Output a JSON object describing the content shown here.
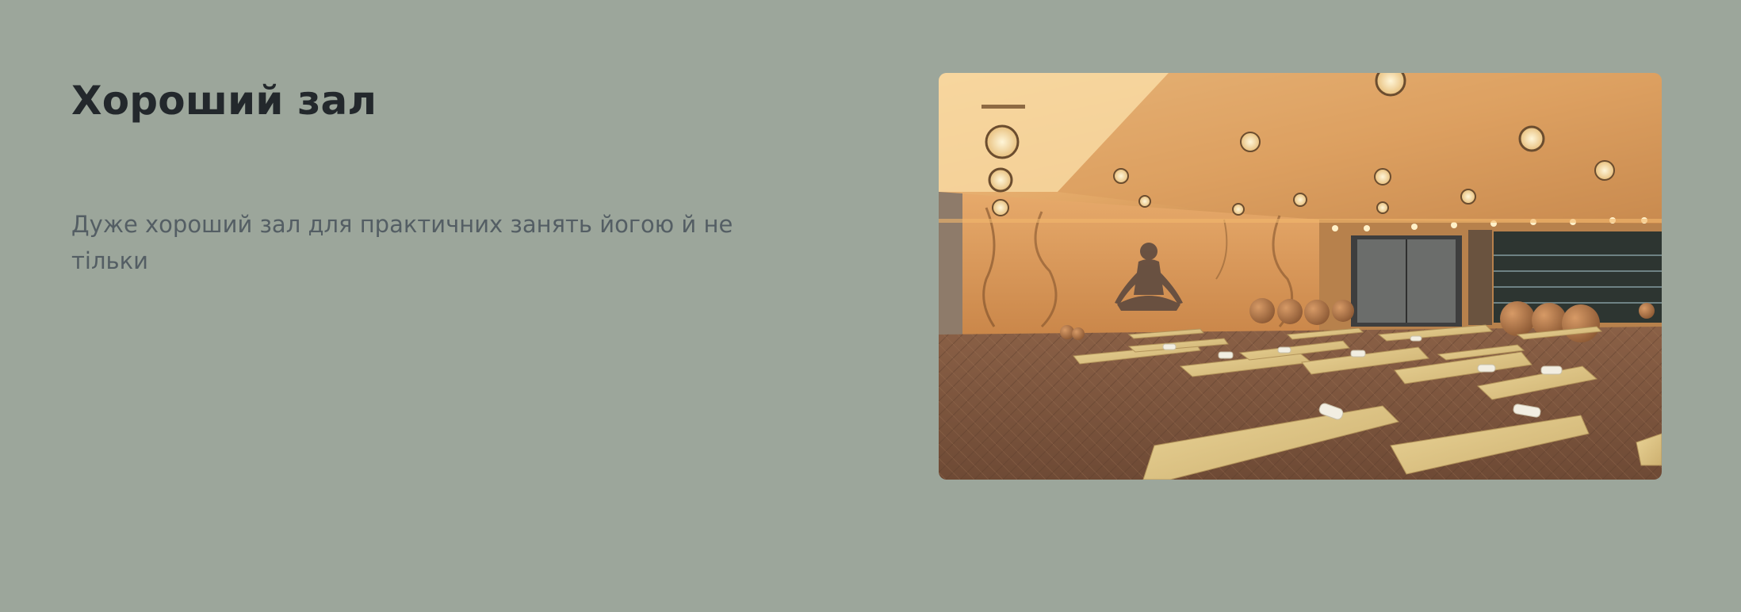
{
  "section": {
    "title": "Хороший зал",
    "description": "Дуже хороший зал для практичних занять йогою й не тільки"
  },
  "image": {
    "subject": "yoga-hall-photo"
  },
  "colors": {
    "background": "#9ca69b",
    "title": "#23282c",
    "description": "#545e64"
  }
}
